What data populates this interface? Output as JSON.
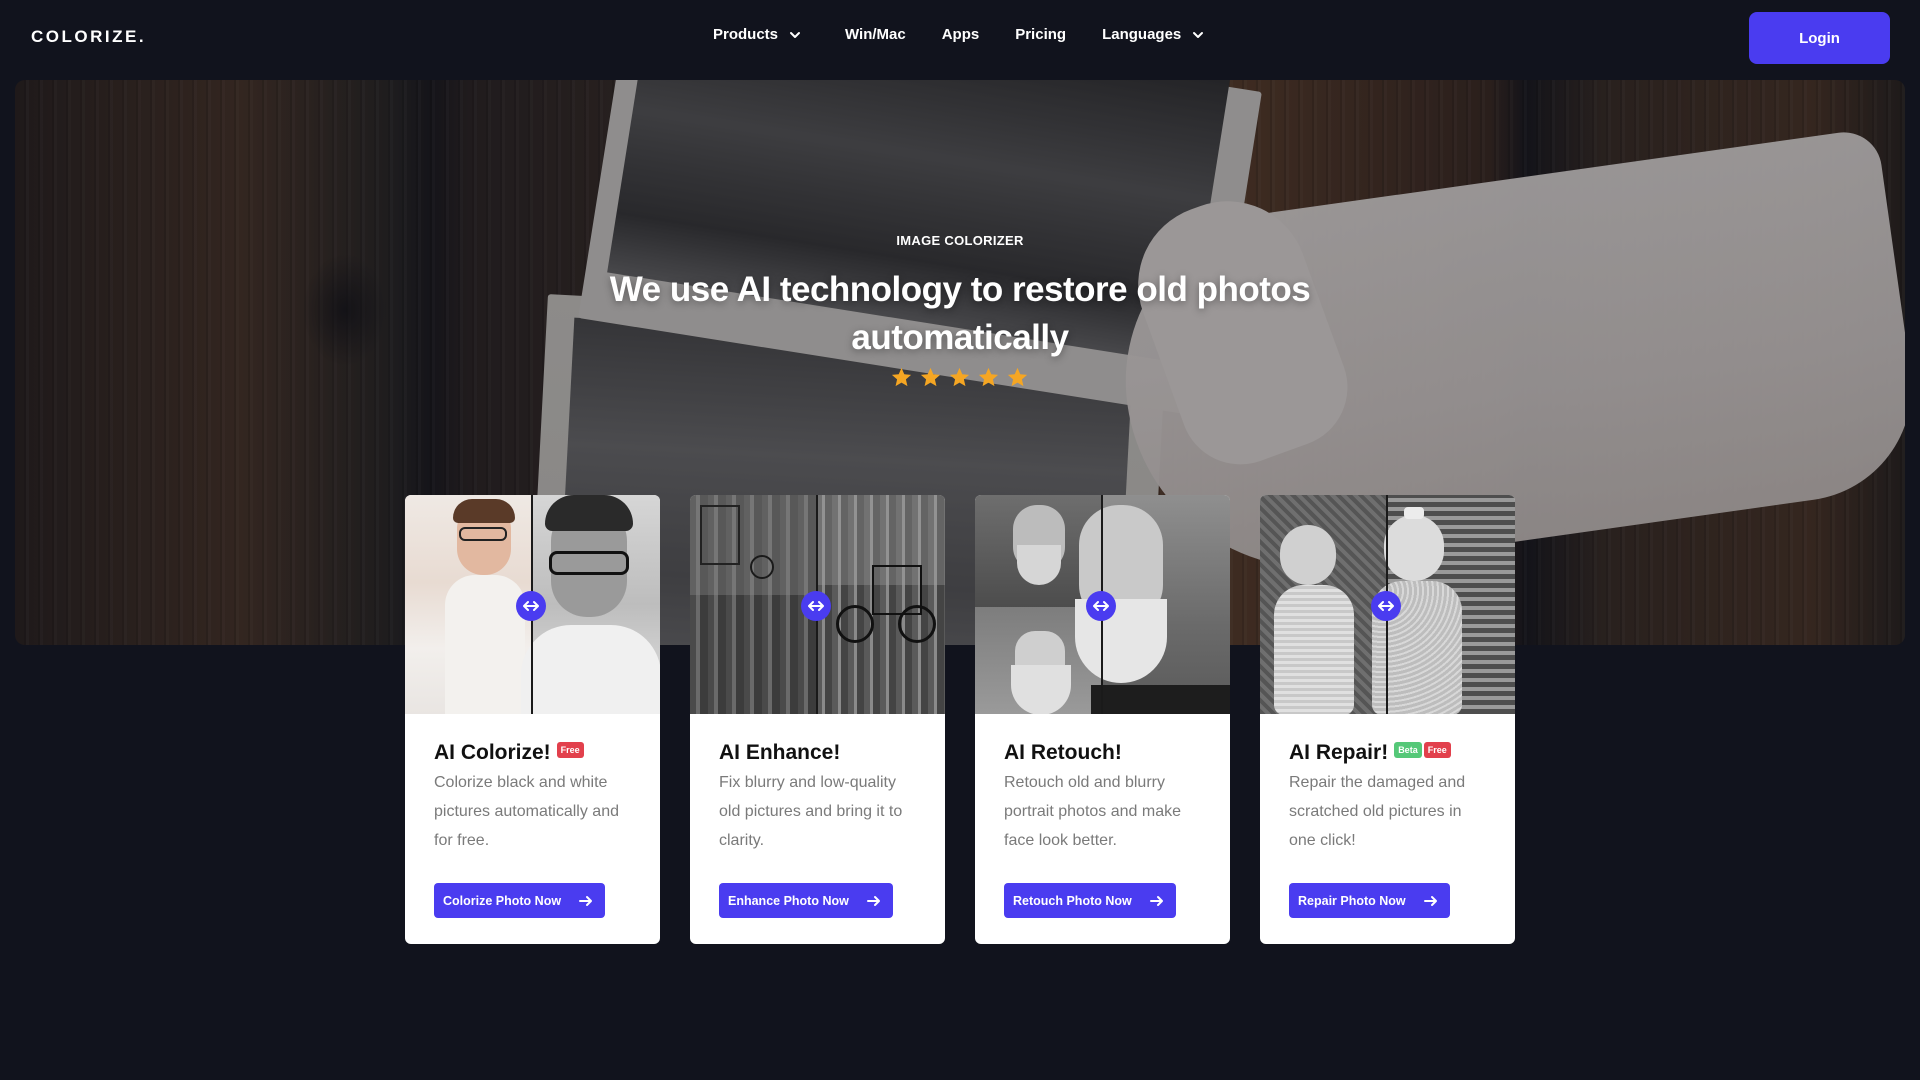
{
  "nav": {
    "logo": "COLORIZE.",
    "menu": [
      {
        "label": "Products",
        "dropdown": true
      },
      {
        "label": "Win/Mac",
        "dropdown": false
      },
      {
        "label": "Apps",
        "dropdown": false
      },
      {
        "label": "Pricing",
        "dropdown": false
      },
      {
        "label": "Languages",
        "dropdown": true
      }
    ],
    "login_label": "Login"
  },
  "hero": {
    "eyebrow": "IMAGE COLORIZER",
    "headline": "We use AI technology to restore old photos automatically",
    "rating_stars": 5
  },
  "cards": [
    {
      "title": "AI Colorize!",
      "tags": [
        "Free"
      ],
      "description": "Colorize black and white pictures automatically and for free.",
      "button_label": "Colorize Photo Now"
    },
    {
      "title": "AI Enhance!",
      "tags": [],
      "description": "Fix blurry and low-quality old pictures and bring it to clarity.",
      "button_label": "Enhance Photo Now"
    },
    {
      "title": "AI Retouch!",
      "tags": [],
      "description": "Retouch old and blurry portrait photos and make face look better.",
      "button_label": "Retouch Photo Now"
    },
    {
      "title": "AI Repair!",
      "tags": [
        "Beta",
        "Free"
      ],
      "description": "Repair the damaged and scratched old pictures in one click!",
      "button_label": "Repair Photo Now"
    }
  ],
  "colors": {
    "background": "#11131d",
    "accent": "#4a3cf0",
    "star": "#f5a623",
    "tag_free": "#e2404c",
    "tag_beta": "#55c878"
  }
}
